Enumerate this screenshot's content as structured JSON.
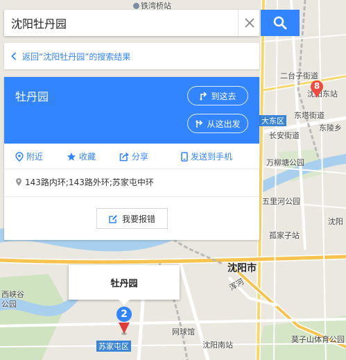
{
  "search": {
    "value": "沈阳牡丹园",
    "placeholder": ""
  },
  "back_link": {
    "label": "返回“沈阳牡丹园”的搜索结果"
  },
  "place": {
    "title": "牡丹园",
    "go_here": "到这去",
    "from_here": "从这出发",
    "actions": {
      "nearby": "附近",
      "favorite": "收藏",
      "share": "分享",
      "send_to_phone": "发送到手机"
    },
    "address": "143路内环;143路外环;苏家屯中环",
    "report": "我要报错"
  },
  "bubble": {
    "title": "牡丹园"
  },
  "markers": {
    "main": "2",
    "other": "8"
  },
  "map_labels": {
    "tiexi_bridge": "铁湾桥站",
    "ertaizi": "二台子街道",
    "shenyang_east": "沈阳东站",
    "dongta": "东塔街道",
    "dongling": "东陵乡",
    "dadong": "大东区",
    "changan": "长安街道",
    "wanliu": "万柳塘公园",
    "wulihe": "五里河公园",
    "shenyang_city": "沈阳市",
    "gujiazi": "孤家子站",
    "hunhe": "浑河",
    "hunnan": "沈阳",
    "shenyang_south": "沈阳南站",
    "wangqiu": "网球馆",
    "sujiatun": "苏家屯区",
    "xixi": "西峡谷",
    "park": "公园",
    "moshan": "莫子山体育公园"
  },
  "colors": {
    "accent": "#3385ff",
    "marker_main": "#3385ff",
    "marker_pin": "#e03b3b",
    "marker_other": "#ef4b3f"
  }
}
